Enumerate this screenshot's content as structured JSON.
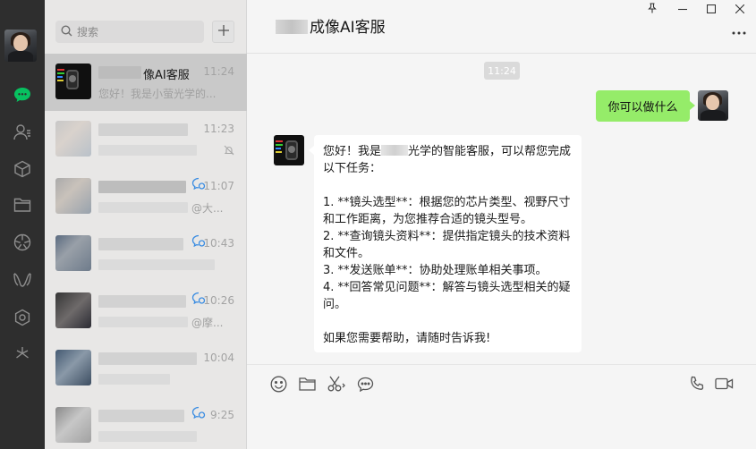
{
  "search": {
    "placeholder": "搜索"
  },
  "chats": [
    {
      "name": "像AI客服",
      "time": "11:24",
      "preview": "您好！我是小萤光学的...",
      "active": true
    },
    {
      "name": "",
      "time": "11:23",
      "preview": "",
      "muted": true
    },
    {
      "name": "",
      "time": "11:07",
      "preview": "@大...",
      "mention": true
    },
    {
      "name": "",
      "time": "10:43",
      "preview": "",
      "mention": true
    },
    {
      "name": "",
      "time": "10:26",
      "preview": "@摩...",
      "mention": true
    },
    {
      "name": "",
      "time": "10:04",
      "preview": ""
    },
    {
      "name": "",
      "time": "9:25",
      "preview": "",
      "mention": true
    }
  ],
  "conversation": {
    "title": "成像AI客服",
    "timestamp": "11:24",
    "outgoing_message": "你可以做什么",
    "reply": {
      "intro_a": "您好！我是",
      "intro_b": "光学的智能客服，可以帮您完成以下任务：",
      "item1": "1. **镜头选型**：根据您的芯片类型、视野尺寸和工作距离，为您推荐合适的镜头型号。",
      "item2": "2. **查询镜头资料**：提供指定镜头的技术资料和文件。",
      "item3": "3. **发送账单**：协助处理账单相关事项。",
      "item4": "4. **回答常见问题**：解答与镜头选型相关的疑问。",
      "closing": "如果您需要帮助，请随时告诉我!"
    }
  },
  "colors": {
    "rail": "#2e2e2e",
    "accent_green": "#07c160",
    "bubble_green": "#95ec69"
  }
}
